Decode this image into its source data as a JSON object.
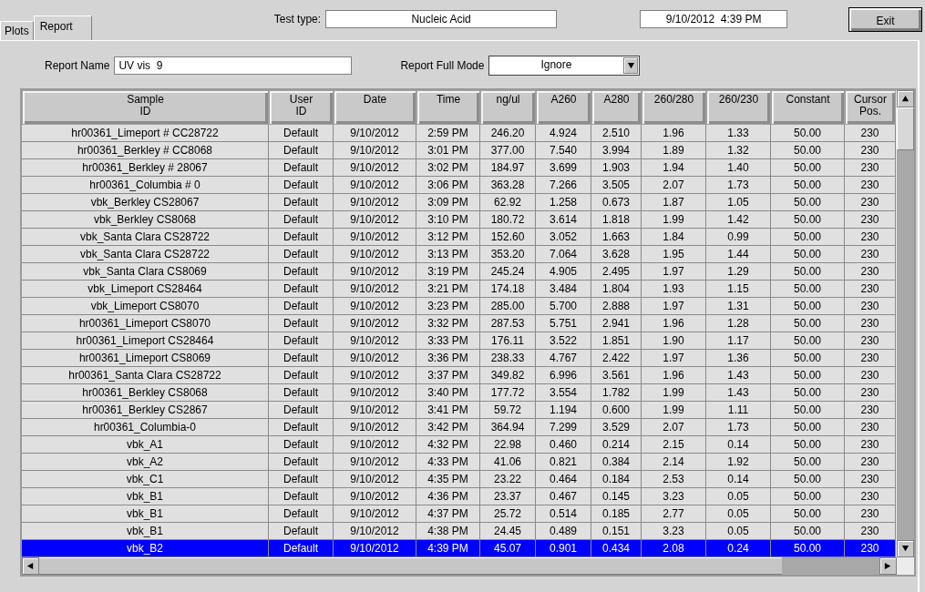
{
  "tabs": [
    {
      "label": "Plots",
      "selected": false
    },
    {
      "label": "Report",
      "selected": true
    }
  ],
  "test_type": {
    "label": "Test type:",
    "value": "Nucleic Acid"
  },
  "datetime": "9/10/2012  4:39 PM",
  "exit_button": "Exit",
  "report_name": {
    "label": "Report Name",
    "value": "UV vis  9"
  },
  "report_full_mode": {
    "label": "Report Full Mode",
    "value": "Ignore"
  },
  "table": {
    "columns": [
      "Sample\nID",
      "User\nID",
      "Date",
      "Time",
      "ng/ul",
      "A260",
      "A280",
      "260/280",
      "260/230",
      "Constant",
      "Cursor\nPos."
    ],
    "rows": [
      {
        "selected": false,
        "cells": [
          "hr00361_Limeport # CC28722",
          "Default",
          "9/10/2012",
          "2:59 PM",
          "246.20",
          "4.924",
          "2.510",
          "1.96",
          "1.33",
          "50.00",
          "230"
        ]
      },
      {
        "selected": false,
        "cells": [
          "hr00361_Berkley # CC8068",
          "Default",
          "9/10/2012",
          "3:01 PM",
          "377.00",
          "7.540",
          "3.994",
          "1.89",
          "1.32",
          "50.00",
          "230"
        ]
      },
      {
        "selected": false,
        "cells": [
          "hr00361_Berkley # 28067",
          "Default",
          "9/10/2012",
          "3:02 PM",
          "184.97",
          "3.699",
          "1.903",
          "1.94",
          "1.40",
          "50.00",
          "230"
        ]
      },
      {
        "selected": false,
        "cells": [
          "hr00361_Columbia # 0",
          "Default",
          "9/10/2012",
          "3:06 PM",
          "363.28",
          "7.266",
          "3.505",
          "2.07",
          "1.73",
          "50.00",
          "230"
        ]
      },
      {
        "selected": false,
        "cells": [
          "vbk_Berkley CS28067",
          "Default",
          "9/10/2012",
          "3:09 PM",
          "62.92",
          "1.258",
          "0.673",
          "1.87",
          "1.05",
          "50.00",
          "230"
        ]
      },
      {
        "selected": false,
        "cells": [
          "vbk_Berkley CS8068",
          "Default",
          "9/10/2012",
          "3:10 PM",
          "180.72",
          "3.614",
          "1.818",
          "1.99",
          "1.42",
          "50.00",
          "230"
        ]
      },
      {
        "selected": false,
        "cells": [
          "vbk_Santa Clara CS28722",
          "Default",
          "9/10/2012",
          "3:12 PM",
          "152.60",
          "3.052",
          "1.663",
          "1.84",
          "0.99",
          "50.00",
          "230"
        ]
      },
      {
        "selected": false,
        "cells": [
          "vbk_Santa Clara CS28722",
          "Default",
          "9/10/2012",
          "3:13 PM",
          "353.20",
          "7.064",
          "3.628",
          "1.95",
          "1.44",
          "50.00",
          "230"
        ]
      },
      {
        "selected": false,
        "cells": [
          "vbk_Santa Clara CS8069",
          "Default",
          "9/10/2012",
          "3:19 PM",
          "245.24",
          "4.905",
          "2.495",
          "1.97",
          "1.29",
          "50.00",
          "230"
        ]
      },
      {
        "selected": false,
        "cells": [
          "vbk_Limeport CS28464",
          "Default",
          "9/10/2012",
          "3:21 PM",
          "174.18",
          "3.484",
          "1.804",
          "1.93",
          "1.15",
          "50.00",
          "230"
        ]
      },
      {
        "selected": false,
        "cells": [
          "vbk_Limeport CS8070",
          "Default",
          "9/10/2012",
          "3:23 PM",
          "285.00",
          "5.700",
          "2.888",
          "1.97",
          "1.31",
          "50.00",
          "230"
        ]
      },
      {
        "selected": false,
        "cells": [
          "hr00361_Limeport CS8070",
          "Default",
          "9/10/2012",
          "3:32 PM",
          "287.53",
          "5.751",
          "2.941",
          "1.96",
          "1.28",
          "50.00",
          "230"
        ]
      },
      {
        "selected": false,
        "cells": [
          "hr00361_Limeport CS28464",
          "Default",
          "9/10/2012",
          "3:33 PM",
          "176.11",
          "3.522",
          "1.851",
          "1.90",
          "1.17",
          "50.00",
          "230"
        ]
      },
      {
        "selected": false,
        "cells": [
          "hr00361_Limeport CS8069",
          "Default",
          "9/10/2012",
          "3:36 PM",
          "238.33",
          "4.767",
          "2.422",
          "1.97",
          "1.36",
          "50.00",
          "230"
        ]
      },
      {
        "selected": false,
        "cells": [
          "hr00361_Santa Clara CS28722",
          "Default",
          "9/10/2012",
          "3:37 PM",
          "349.82",
          "6.996",
          "3.561",
          "1.96",
          "1.43",
          "50.00",
          "230"
        ]
      },
      {
        "selected": false,
        "cells": [
          "hr00361_Berkley CS8068",
          "Default",
          "9/10/2012",
          "3:40 PM",
          "177.72",
          "3.554",
          "1.782",
          "1.99",
          "1.43",
          "50.00",
          "230"
        ]
      },
      {
        "selected": false,
        "cells": [
          "hr00361_Berkley CS2867",
          "Default",
          "9/10/2012",
          "3:41 PM",
          "59.72",
          "1.194",
          "0.600",
          "1.99",
          "1.11",
          "50.00",
          "230"
        ]
      },
      {
        "selected": false,
        "cells": [
          "hr00361_Columbia-0",
          "Default",
          "9/10/2012",
          "3:42 PM",
          "364.94",
          "7.299",
          "3.529",
          "2.07",
          "1.73",
          "50.00",
          "230"
        ]
      },
      {
        "selected": false,
        "cells": [
          "vbk_A1",
          "Default",
          "9/10/2012",
          "4:32 PM",
          "22.98",
          "0.460",
          "0.214",
          "2.15",
          "0.14",
          "50.00",
          "230"
        ]
      },
      {
        "selected": false,
        "cells": [
          "vbk_A2",
          "Default",
          "9/10/2012",
          "4:33 PM",
          "41.06",
          "0.821",
          "0.384",
          "2.14",
          "1.92",
          "50.00",
          "230"
        ]
      },
      {
        "selected": false,
        "cells": [
          "vbk_C1",
          "Default",
          "9/10/2012",
          "4:35 PM",
          "23.22",
          "0.464",
          "0.184",
          "2.53",
          "0.14",
          "50.00",
          "230"
        ]
      },
      {
        "selected": false,
        "cells": [
          "vbk_B1",
          "Default",
          "9/10/2012",
          "4:36 PM",
          "23.37",
          "0.467",
          "0.145",
          "3.23",
          "0.05",
          "50.00",
          "230"
        ]
      },
      {
        "selected": false,
        "cells": [
          "vbk_B1",
          "Default",
          "9/10/2012",
          "4:37 PM",
          "25.72",
          "0.514",
          "0.185",
          "2.77",
          "0.05",
          "50.00",
          "230"
        ]
      },
      {
        "selected": false,
        "cells": [
          "vbk_B1",
          "Default",
          "9/10/2012",
          "4:38 PM",
          "24.45",
          "0.489",
          "0.151",
          "3.23",
          "0.05",
          "50.00",
          "230"
        ]
      },
      {
        "selected": true,
        "cells": [
          "vbk_B2",
          "Default",
          "9/10/2012",
          "4:39 PM",
          "45.07",
          "0.901",
          "0.434",
          "2.08",
          "0.24",
          "50.00",
          "230"
        ]
      }
    ]
  }
}
